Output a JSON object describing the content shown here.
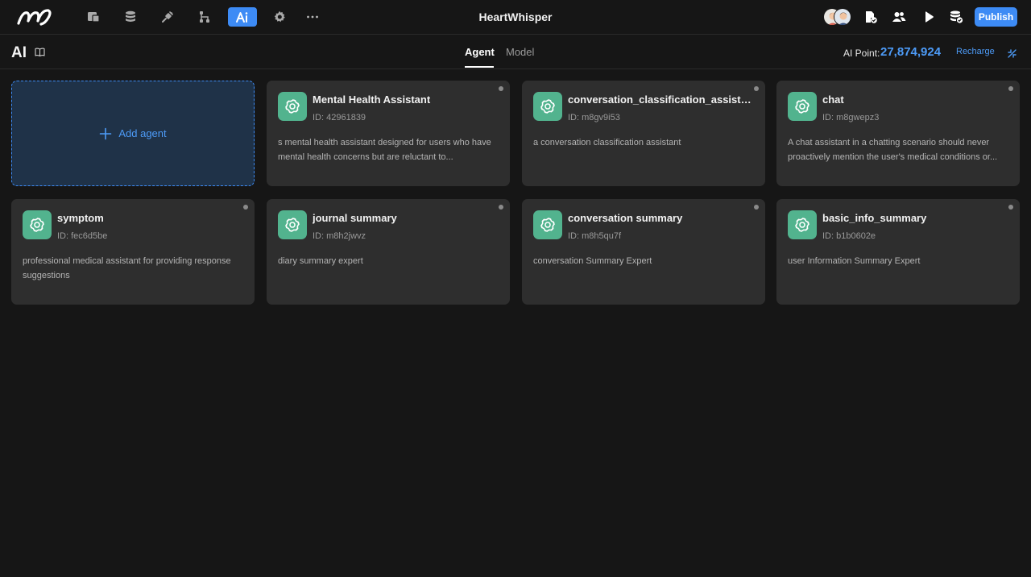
{
  "header": {
    "app_title": "HeartWhisper",
    "publish_label": "Publish",
    "tools": [
      {
        "icon": "pages-icon",
        "active": false
      },
      {
        "icon": "database-icon",
        "active": false
      },
      {
        "icon": "plugin-icon",
        "active": false
      },
      {
        "icon": "workflow-icon",
        "active": false
      },
      {
        "icon": "ai-icon",
        "active": true
      },
      {
        "icon": "settings-icon",
        "active": false
      },
      {
        "icon": "more-icon",
        "active": false
      }
    ],
    "right_icons": [
      "document-check-icon",
      "users-icon",
      "play-icon",
      "database-check-icon"
    ]
  },
  "subheader": {
    "title": "AI",
    "tabs": [
      {
        "label": "Agent",
        "active": true
      },
      {
        "label": "Model",
        "active": false
      }
    ],
    "points_label": "AI Point:",
    "points_value": "27,874,924",
    "recharge_label": "Recharge"
  },
  "add_agent_label": "Add agent",
  "agents": [
    {
      "name": "Mental Health Assistant",
      "id": "ID: 42961839",
      "description": "s mental health assistant designed for users who have mental health concerns but are reluctant to..."
    },
    {
      "name": "conversation_classification_assistant",
      "id": "ID: m8gv9i53",
      "description": "a conversation classification assistant"
    },
    {
      "name": "chat",
      "id": "ID: m8gwepz3",
      "description": "A chat assistant in a chatting scenario should never proactively mention the user's medical conditions or..."
    },
    {
      "name": "symptom",
      "id": "ID: fec6d5be",
      "description": "professional medical assistant for providing response suggestions"
    },
    {
      "name": "journal summary",
      "id": "ID: m8h2jwvz",
      "description": "diary summary expert"
    },
    {
      "name": "conversation summary",
      "id": "ID: m8h5qu7f",
      "description": "conversation Summary Expert"
    },
    {
      "name": "basic_info_summary",
      "id": "ID: b1b0602e",
      "description": "user Information Summary Expert"
    }
  ],
  "colors": {
    "accent": "#3d8bf5",
    "agent_icon_bg": "#52b38e",
    "card_bg": "#2e2e2e",
    "page_bg": "#161616"
  }
}
